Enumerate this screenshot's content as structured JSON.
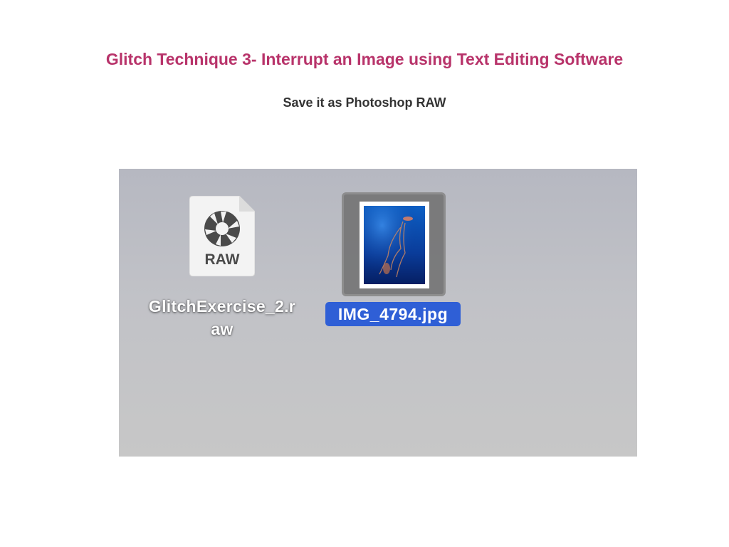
{
  "slide": {
    "title": "Glitch Technique 3- Interrupt an Image using Text Editing Software",
    "subtitle": "Save it as Photoshop RAW"
  },
  "desktop": {
    "files": [
      {
        "name_line1": "GlitchExercise_2.r",
        "name_line2": "aw",
        "icon": "raw-file-icon",
        "icon_label": "RAW",
        "selected": false
      },
      {
        "name": "IMG_4794.jpg",
        "icon": "jpg-thumbnail-icon",
        "selected": true
      }
    ]
  },
  "colors": {
    "title": "#b8336a",
    "subtitle": "#333333",
    "selection_highlight": "#2f5fd6"
  }
}
